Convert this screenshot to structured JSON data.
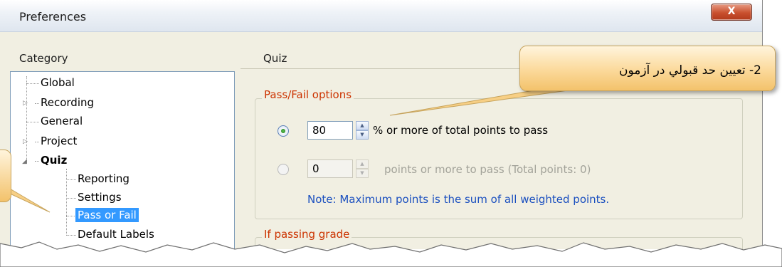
{
  "window": {
    "title": "Preferences",
    "close_label": "X"
  },
  "sidebar": {
    "label": "Category",
    "items": [
      {
        "label": "Global"
      },
      {
        "label": "Recording"
      },
      {
        "label": "General"
      },
      {
        "label": "Project"
      },
      {
        "label": "Quiz"
      },
      {
        "label": "Reporting"
      },
      {
        "label": "Settings"
      },
      {
        "label": "Pass or Fail"
      },
      {
        "label": "Default Labels"
      }
    ]
  },
  "main": {
    "section_title": "Quiz",
    "pass_fail": {
      "legend": "Pass/Fail options",
      "percent_value": "80",
      "percent_text": "% or more of total points to pass",
      "points_value": "0",
      "points_text": "points or more to pass (Total points: 0)",
      "note": "Note: Maximum points is the sum of all weighted points."
    },
    "passing_grade": {
      "legend": "If passing grade"
    }
  },
  "callout": {
    "text": "2- تعيين حد قبولي در آزمون"
  },
  "colors": {
    "accent_red": "#cc3300",
    "note_blue": "#1a4fbf",
    "selection": "#3399ff",
    "callout_fill": "#fbd99a"
  }
}
